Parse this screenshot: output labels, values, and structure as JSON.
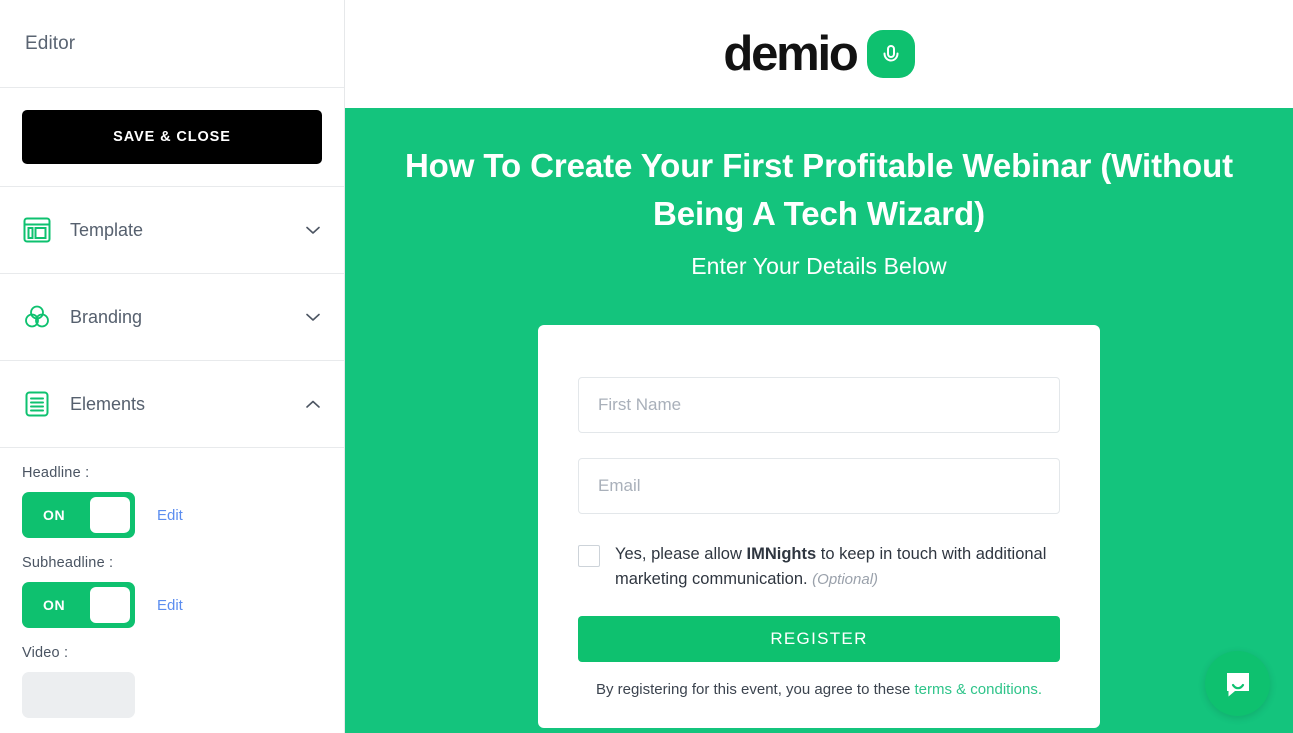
{
  "sidebar": {
    "title": "Editor",
    "save_label": "SAVE & CLOSE",
    "nav": [
      {
        "label": "Template",
        "icon": "template-icon",
        "chevron": "chevron-down-icon",
        "expanded": false
      },
      {
        "label": "Branding",
        "icon": "branding-circles-icon",
        "chevron": "chevron-down-icon",
        "expanded": false
      },
      {
        "label": "Elements",
        "icon": "elements-lines-icon",
        "chevron": "chevron-up-icon",
        "expanded": true
      }
    ],
    "elements": [
      {
        "label": "Headline :",
        "toggle_state": "ON",
        "edit_label": "Edit"
      },
      {
        "label": "Subheadline :",
        "toggle_state": "ON",
        "edit_label": "Edit"
      },
      {
        "label": "Video :",
        "toggle_state": "",
        "edit_label": ""
      }
    ]
  },
  "preview": {
    "logo_text": "demio",
    "logo_mark": "microphone-icon",
    "headline": "How To Create Your First Profitable Webinar (Without Being A Tech Wizard)",
    "subheadline": "Enter Your Details Below",
    "form": {
      "first_name_placeholder": "First Name",
      "first_name_value": "",
      "email_placeholder": "Email",
      "email_value": "",
      "consent_prefix": "Yes, please allow ",
      "consent_brand": "IMNights",
      "consent_suffix": " to keep in touch with additional marketing communication. ",
      "consent_optional": "(Optional)",
      "register_label": "REGISTER",
      "terms_prefix": "By registering for this event, you agree to these ",
      "terms_link": "terms & conditions."
    },
    "chat_widget": "chat-bubble-icon"
  },
  "colors": {
    "brand_green": "#0ec16f",
    "hero_green": "#14c47d",
    "link_blue": "#5b8def",
    "terms_green": "#2fc48a",
    "save_black": "#000000"
  }
}
